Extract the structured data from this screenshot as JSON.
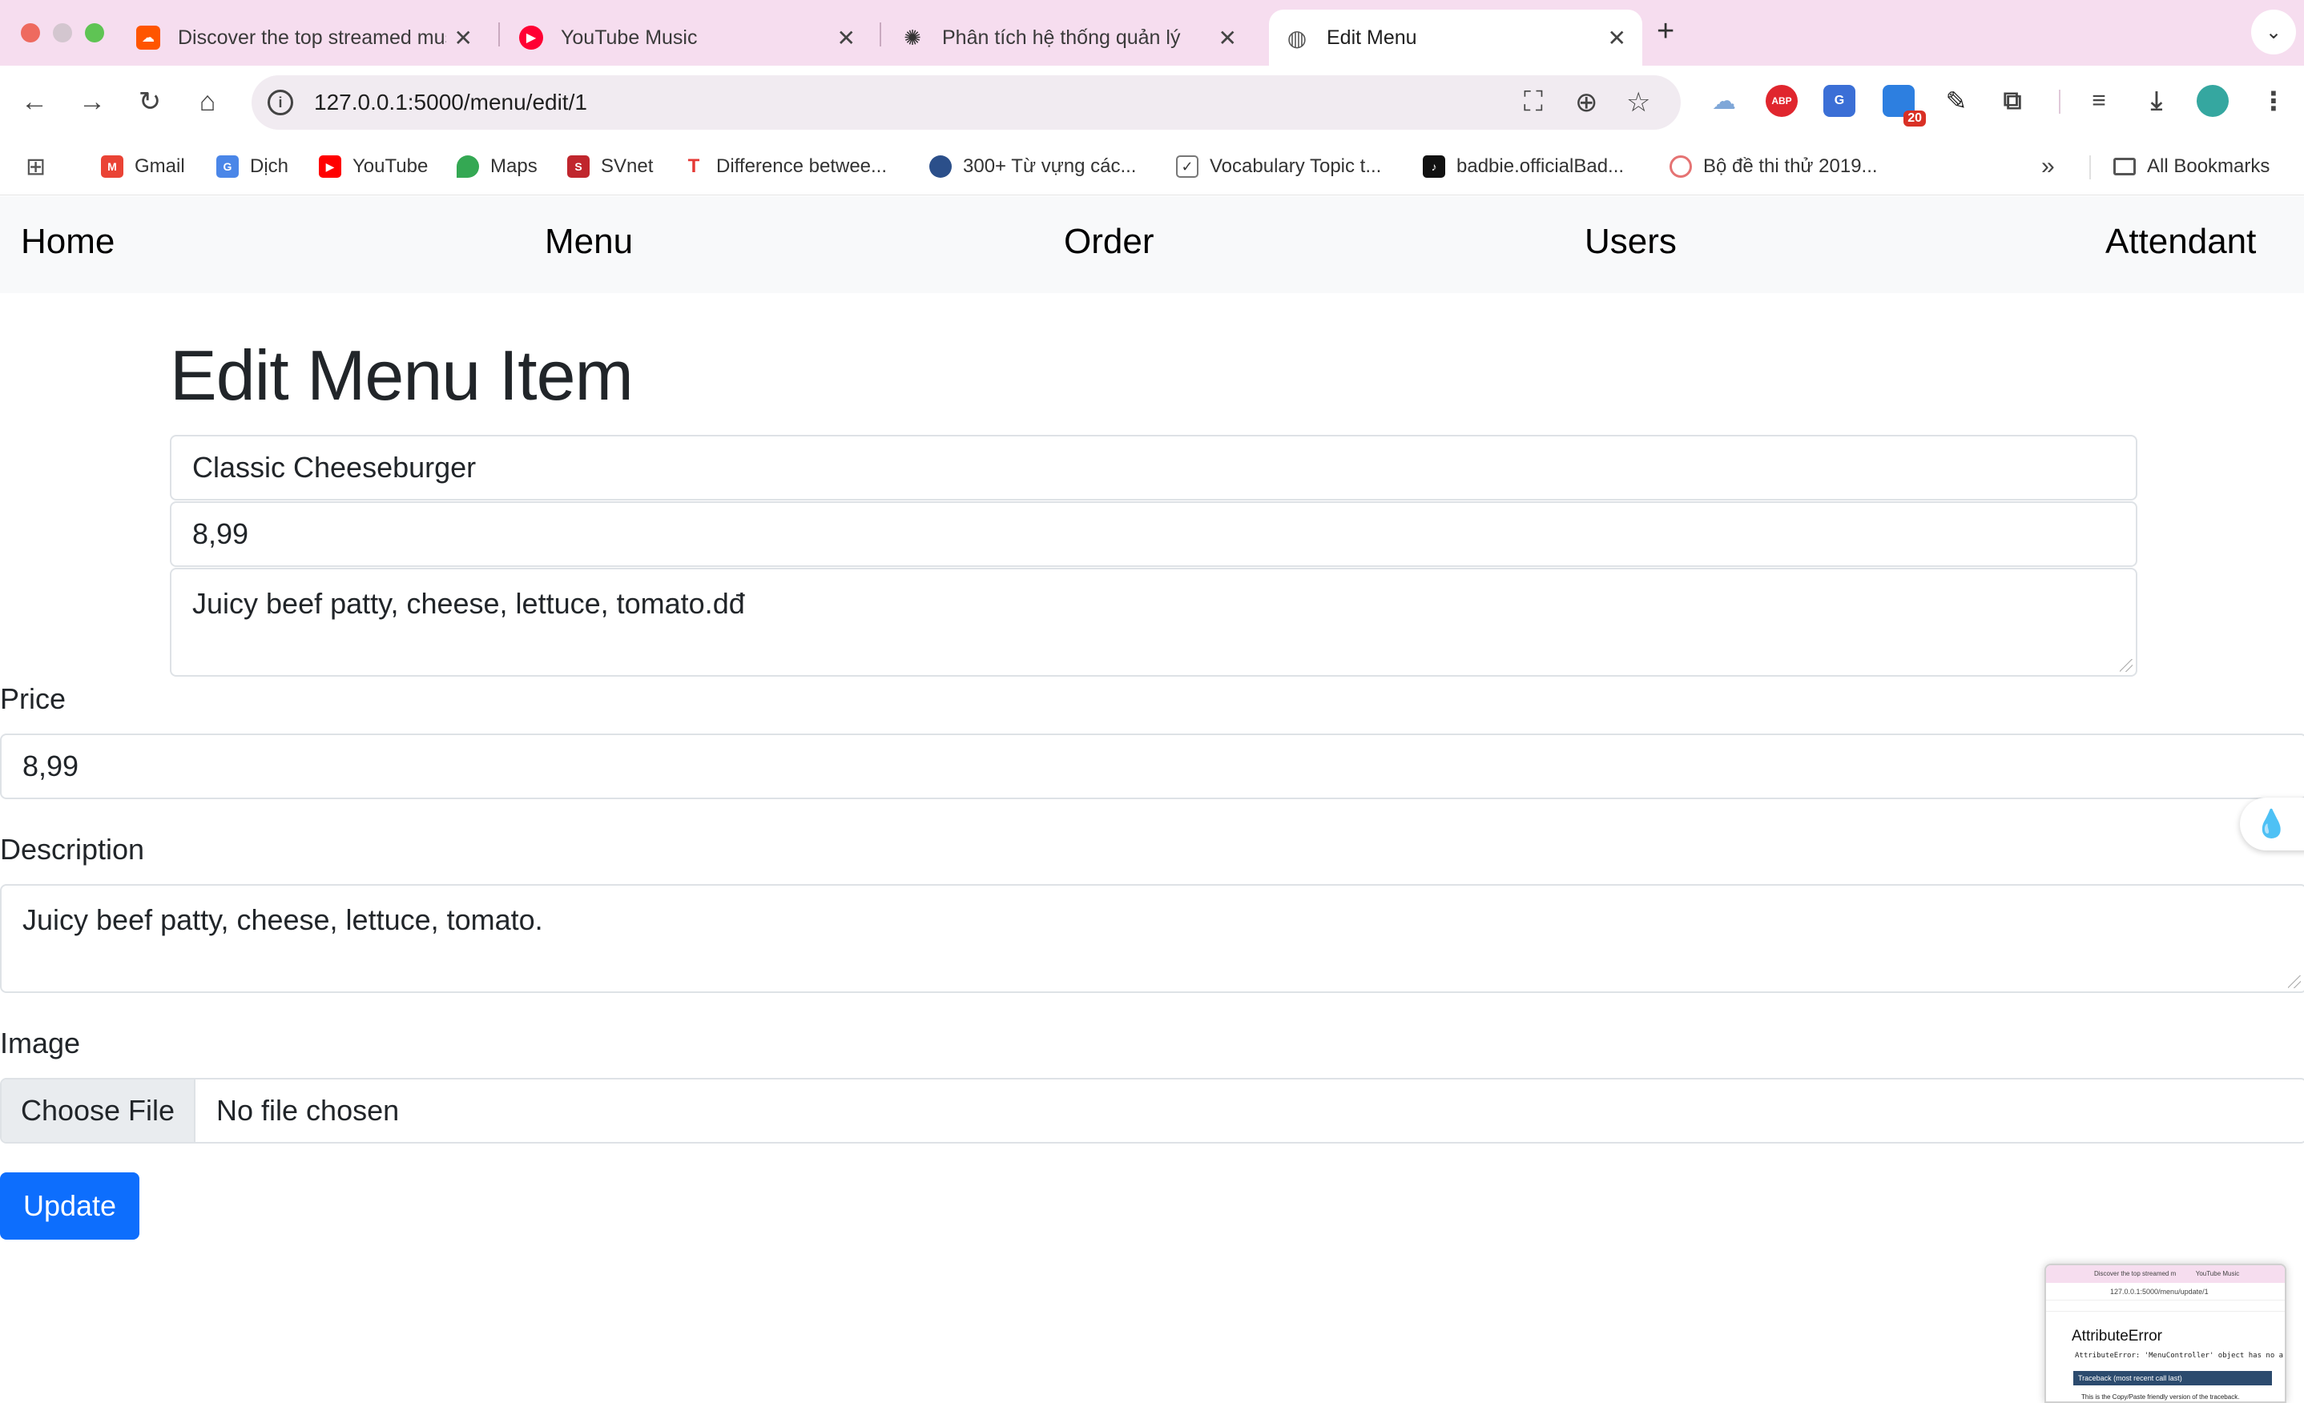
{
  "browser": {
    "tabs": [
      {
        "label": "Discover the top streamed music",
        "favicon": "soundcloud-icon",
        "color": "#ff5500"
      },
      {
        "label": "YouTube Music",
        "favicon": "youtube-music-icon",
        "color": "#ff0033"
      },
      {
        "label": "Phân tích hệ thống quản lý",
        "favicon": "openai-icon",
        "color": "#333333"
      },
      {
        "label": "Edit Menu",
        "favicon": "globe-icon",
        "color": "#555555",
        "active": true
      }
    ],
    "url": "127.0.0.1:5000/menu/edit/1",
    "extension_badge": "20",
    "bookmarks": [
      {
        "label": "Gmail",
        "icon": "gmail-icon"
      },
      {
        "label": "Dịch",
        "icon": "google-translate-icon"
      },
      {
        "label": "YouTube",
        "icon": "youtube-icon"
      },
      {
        "label": "Maps",
        "icon": "maps-icon"
      },
      {
        "label": "SVnet",
        "icon": "svnet-icon"
      },
      {
        "label": "Difference betwee...",
        "icon": "t-logo-icon"
      },
      {
        "label": "300+ Từ vựng các...",
        "icon": "circle-logo-icon"
      },
      {
        "label": "Vocabulary Topic t...",
        "icon": "checkmark-icon"
      },
      {
        "label": "badbie.officialBad...",
        "icon": "tiktok-icon"
      },
      {
        "label": "Bộ đề thi thử 2019...",
        "icon": "target-icon"
      }
    ],
    "all_bookmarks_label": "All Bookmarks"
  },
  "nav": {
    "home": "Home",
    "menu": "Menu",
    "order": "Order",
    "users": "Users",
    "attendant": "Attendant"
  },
  "page": {
    "title": "Edit Menu Item",
    "name_value": "Classic Cheeseburger",
    "price_value_top": "8,99",
    "description_value_top": "Juicy beef patty, cheese, lettuce, tomato.dđ",
    "price_label": "Price",
    "price_value": "8,99",
    "description_label": "Description",
    "description_value": "Juicy beef patty, cheese, lettuce, tomato.",
    "image_label": "Image",
    "choose_file_label": "Choose File",
    "no_file_label": "No file chosen",
    "update_label": "Update"
  },
  "thumbnail": {
    "error_title": "AttributeError",
    "error_message": "AttributeError: 'MenuController' object has no a",
    "traceback_label": "Traceback (most recent call last)",
    "copy_note": "This is the Copy/Paste friendly version of the traceback.",
    "tab_label": "Discover the top streamed m",
    "tab2_label": "YouTube Music",
    "url": "127.0.0.1:5000/menu/update/1"
  },
  "colors": {
    "primary": "#0d6efd",
    "tabstrip": "#f6ddef",
    "navbar": "#f8f9fa"
  }
}
